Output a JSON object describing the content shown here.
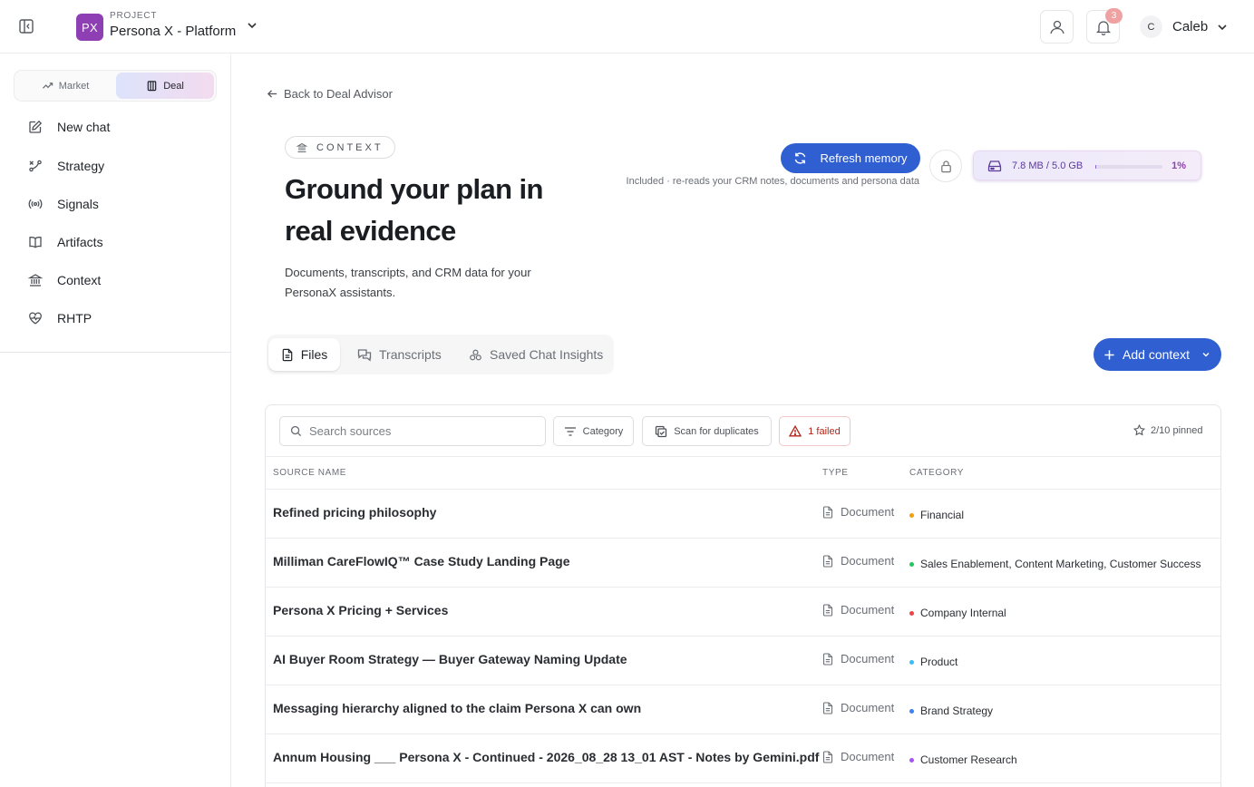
{
  "header": {
    "project_kicker": "PROJECT",
    "project_initials": "PX",
    "project_name": "Persona X - Platform",
    "notification_count": "3",
    "user_initial": "C",
    "user_name": "Caleb"
  },
  "sidebar": {
    "modes": [
      {
        "label": "Market",
        "active": false
      },
      {
        "label": "Deal",
        "active": true
      }
    ],
    "items": [
      {
        "label": "New chat",
        "icon": "edit-icon"
      },
      {
        "label": "Strategy",
        "icon": "strategy-icon"
      },
      {
        "label": "Signals",
        "icon": "signal-icon"
      },
      {
        "label": "Artifacts",
        "icon": "book-icon"
      },
      {
        "label": "Context",
        "icon": "bank-icon"
      },
      {
        "label": "RHTP",
        "icon": "heart-pulse-icon"
      }
    ]
  },
  "main": {
    "back_label": "Back to Deal Advisor",
    "section_pill": "CONTEXT",
    "title": "Ground your plan in real evidence",
    "subtitle": "Documents, transcripts, and CRM data for your PersonaX assistants.",
    "refresh_label": "Refresh memory",
    "refresh_note": "Included · re-reads your CRM notes, documents and persona data",
    "storage": {
      "text": "7.8 MB / 5.0 GB",
      "percent_label": "1%",
      "fraction": 0.01
    },
    "tabs": [
      {
        "label": "Files",
        "active": true
      },
      {
        "label": "Transcripts",
        "active": false
      },
      {
        "label": "Saved Chat Insights",
        "active": false
      }
    ],
    "add_context_label": "Add context",
    "toolbar": {
      "search_placeholder": "Search sources",
      "category_label": "Category",
      "scan_label": "Scan for duplicates",
      "failed_label": "1 failed",
      "pinned_label": "2/10 pinned"
    },
    "table": {
      "columns": [
        "SOURCE NAME",
        "TYPE",
        "CATEGORY"
      ],
      "rows": [
        {
          "name": "Refined pricing philosophy",
          "type": "Document",
          "category": "Financial",
          "dot": "#f59e0b"
        },
        {
          "name": "Milliman CareFlowIQ™ Case Study Landing Page",
          "type": "Document",
          "category": "Sales Enablement, Content Marketing, Customer Success",
          "dot": "#22c55e"
        },
        {
          "name": "Persona X Pricing + Services",
          "type": "Document",
          "category": "Company Internal",
          "dot": "#ef4444"
        },
        {
          "name": "AI Buyer Room Strategy — Buyer Gateway Naming Update",
          "type": "Document",
          "category": "Product",
          "dot": "#38bdf8"
        },
        {
          "name": "Messaging hierarchy aligned to the claim Persona X can own",
          "type": "Document",
          "category": "Brand Strategy",
          "dot": "#3b82f6"
        },
        {
          "name": "Annum Housing ___ Persona X - Continued - 2026_08_28 13_01 AST - Notes by Gemini.pdf",
          "type": "Document",
          "category": "Customer Research",
          "dot": "#a855f7"
        }
      ]
    }
  },
  "colors": {
    "accent": "#2f5fd0",
    "project_avatar": "#8e3fb3",
    "failed": "#b42318"
  }
}
